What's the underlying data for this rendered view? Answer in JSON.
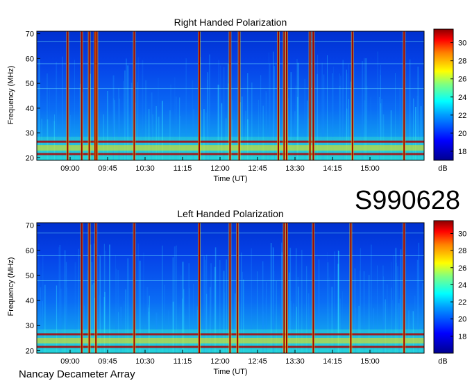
{
  "chart_data": [
    {
      "type": "heatmap",
      "title": "Right Handed Polarization",
      "xlabel": "Time (UT)",
      "ylabel": "Frequency (MHz)",
      "x_ticks": [
        "09:00",
        "09:45",
        "10:30",
        "11:15",
        "12:00",
        "12:45",
        "13:30",
        "14:15",
        "15:00"
      ],
      "x_tick_minutes": [
        540,
        585,
        630,
        675,
        720,
        765,
        810,
        855,
        900
      ],
      "xlim_minutes": [
        500,
        965
      ],
      "y_ticks": [
        20,
        30,
        40,
        50,
        60,
        70
      ],
      "ylim": [
        19,
        71
      ],
      "colorbar": {
        "label": "dB",
        "ticks": [
          18,
          20,
          22,
          24,
          26,
          28,
          30
        ],
        "range": [
          17,
          31.5
        ]
      },
      "bright_vertical_bursts_min": [
        537,
        554,
        563,
        570,
        572,
        617,
        695,
        732,
        743,
        790,
        797,
        800,
        828,
        832,
        879,
        941
      ],
      "bright_bands_mhz": [
        21.5,
        26.5
      ]
    },
    {
      "type": "heatmap",
      "title": "Left Handed Polarization",
      "xlabel": "Time (UT)",
      "ylabel": "Frequency (MHz)",
      "x_ticks": [
        "09:00",
        "09:45",
        "10:30",
        "11:15",
        "12:00",
        "12:45",
        "13:30",
        "14:15",
        "15:00"
      ],
      "x_tick_minutes": [
        540,
        585,
        630,
        675,
        720,
        765,
        810,
        855,
        900
      ],
      "xlim_minutes": [
        500,
        965
      ],
      "y_ticks": [
        20,
        30,
        40,
        50,
        60,
        70
      ],
      "ylim": [
        19,
        71
      ],
      "colorbar": {
        "label": "dB",
        "ticks": [
          18,
          20,
          22,
          24,
          26,
          28,
          30
        ],
        "range": [
          16,
          31.5
        ]
      },
      "bright_vertical_bursts_min": [
        554,
        563,
        571,
        617,
        695,
        732,
        741,
        797,
        800,
        832,
        877,
        941
      ],
      "bright_bands_mhz": [
        21.5,
        26.5
      ]
    }
  ],
  "labels": {
    "date_code": "S990628",
    "footer": "Nancay Decameter Array"
  }
}
